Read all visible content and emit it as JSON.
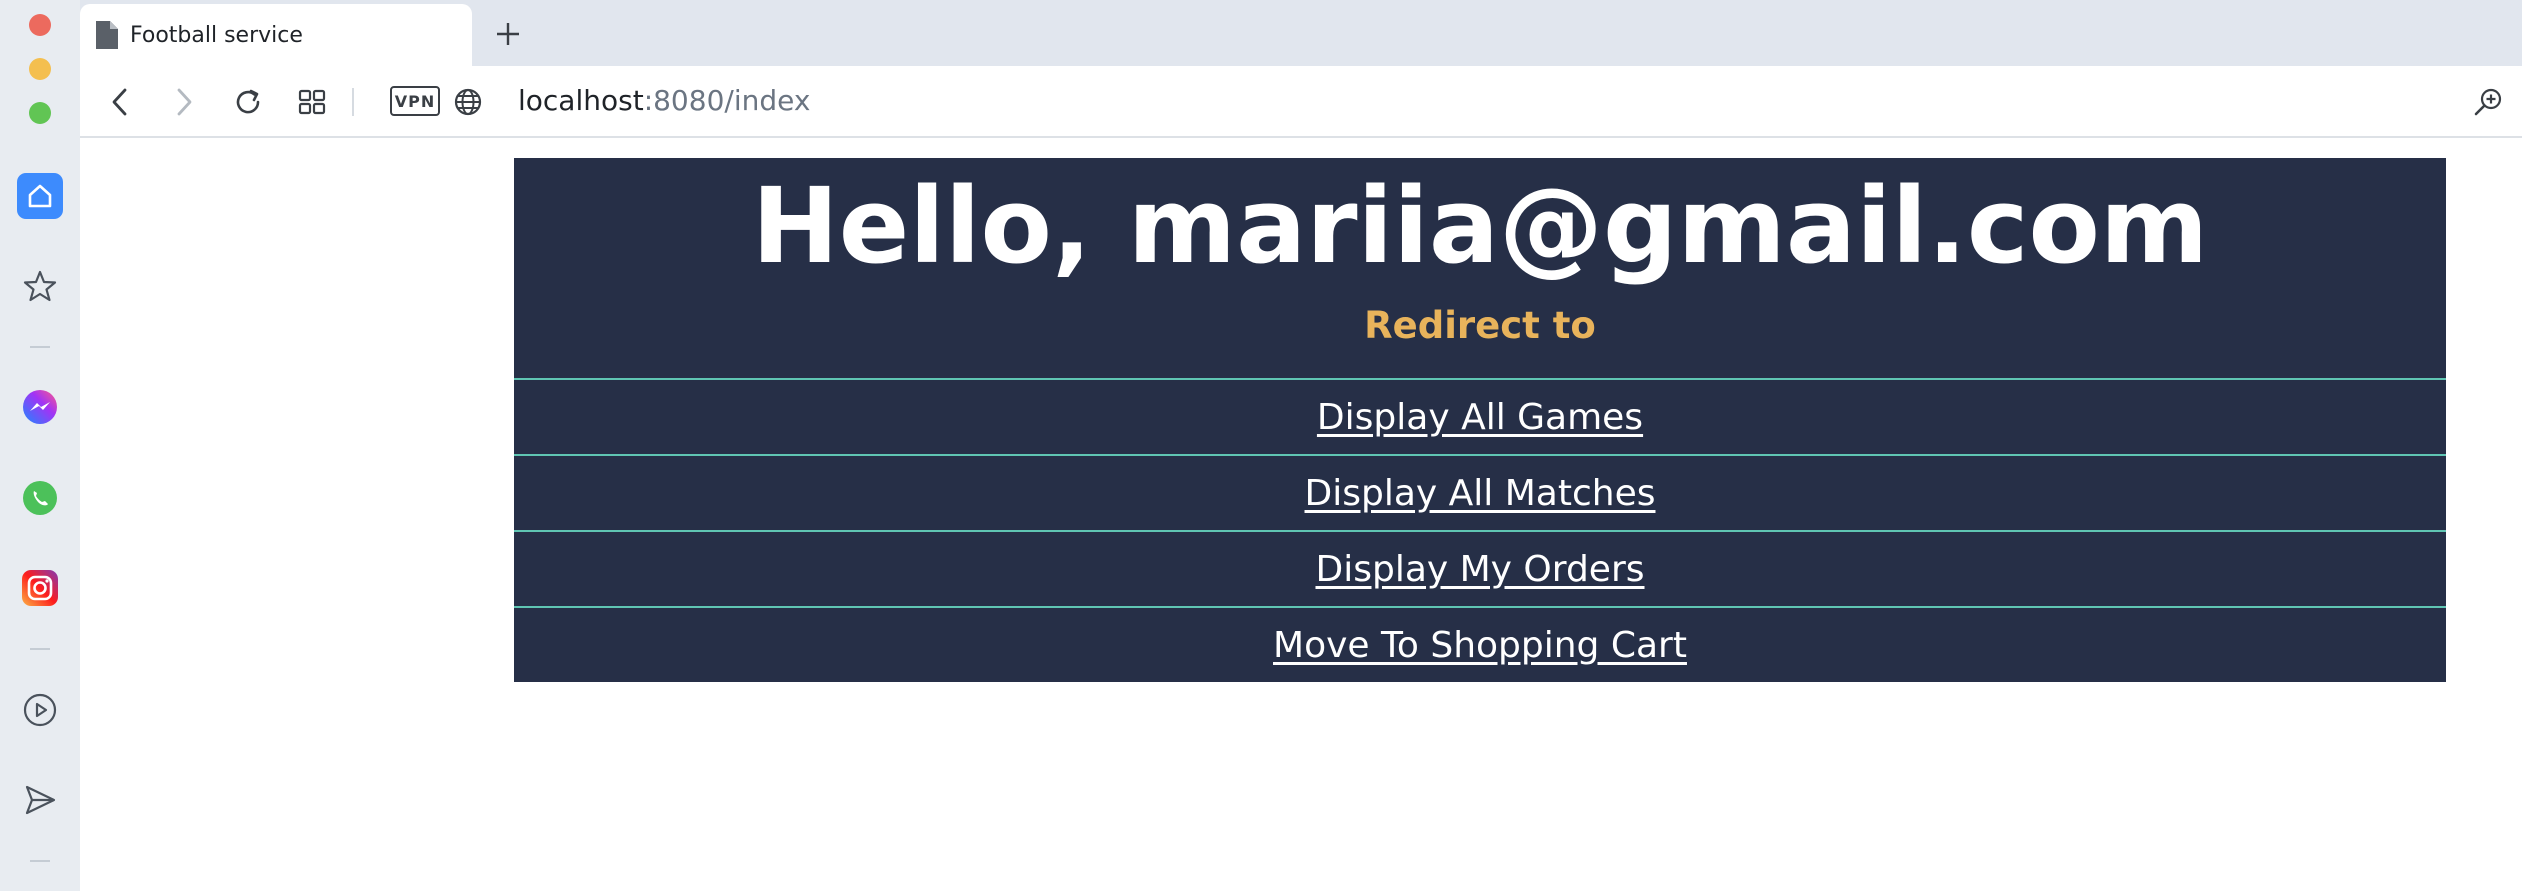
{
  "browser": {
    "tab_title": "Football service",
    "address_host": "localhost",
    "address_path": ":8080/index",
    "vpn_label": "VPN"
  },
  "page": {
    "greeting": "Hello, mariia@gmail.com",
    "redirect_label": "Redirect to",
    "links": [
      {
        "label": "Display All Games"
      },
      {
        "label": "Display All Matches"
      },
      {
        "label": "Display My Orders"
      },
      {
        "label": "Move To Shopping Cart"
      }
    ]
  },
  "colors": {
    "card_bg": "#262f47",
    "accent_orange": "#e8b35b",
    "row_border": "#5fc5b3",
    "sidebar_home": "#3d8bfd"
  }
}
